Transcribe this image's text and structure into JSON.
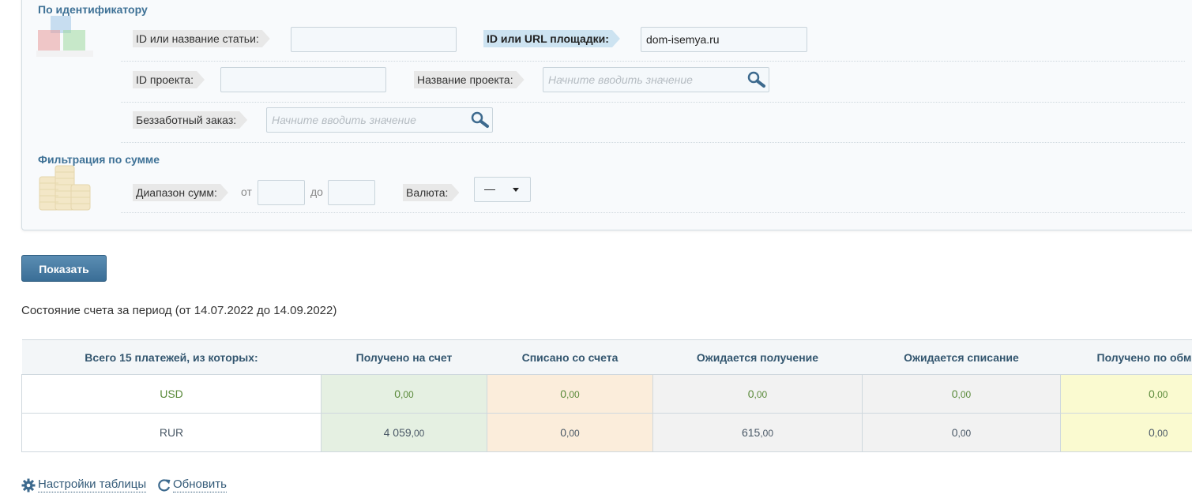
{
  "sections": {
    "by_id_title": "По идентификатору",
    "by_sum_title": "Фильтрация по сумме"
  },
  "fields": {
    "article_label": "ID или название статьи:",
    "article_value": "",
    "platform_label": "ID или URL площадки:",
    "platform_value": "dom-isemya.ru",
    "project_id_label": "ID проекта:",
    "project_id_value": "",
    "project_name_label": "Название проекта:",
    "project_name_placeholder": "Начните вводить значение",
    "order_label": "Беззаботный заказ:",
    "order_placeholder": "Начните вводить значение",
    "range_label": "Диапазон сумм:",
    "from_label": "от",
    "to_label": "до",
    "currency_label": "Валюта:",
    "currency_value": "—"
  },
  "show_button": "Показать",
  "period_text": "Состояние счета за период (от 14.07.2022 до 14.09.2022)",
  "table": {
    "headers": [
      "Всего 15 платежей, из которых:",
      "Получено на счет",
      "Списано со счета",
      "Ожидается получение",
      "Ожидается списание",
      "Получено по обм"
    ],
    "rows": [
      {
        "currency": "USD",
        "cells": [
          [
            "0",
            ",00"
          ],
          [
            "0",
            ",00"
          ],
          [
            "0",
            ",00"
          ],
          [
            "0",
            ",00"
          ],
          [
            "0",
            ",00"
          ]
        ]
      },
      {
        "currency": "RUR",
        "cells": [
          [
            "4 059",
            ",00"
          ],
          [
            "0",
            ",00"
          ],
          [
            "615",
            ",00"
          ],
          [
            "0",
            ",00"
          ],
          [
            "0",
            ",00"
          ]
        ]
      }
    ]
  },
  "footer": {
    "settings": "Настройки таблицы",
    "refresh": "Обновить"
  },
  "icons": {
    "blocks": "blocks-icon",
    "coins": "coins-icon",
    "search": "search-icon",
    "gear": "gear-icon",
    "refresh": "refresh-icon"
  }
}
